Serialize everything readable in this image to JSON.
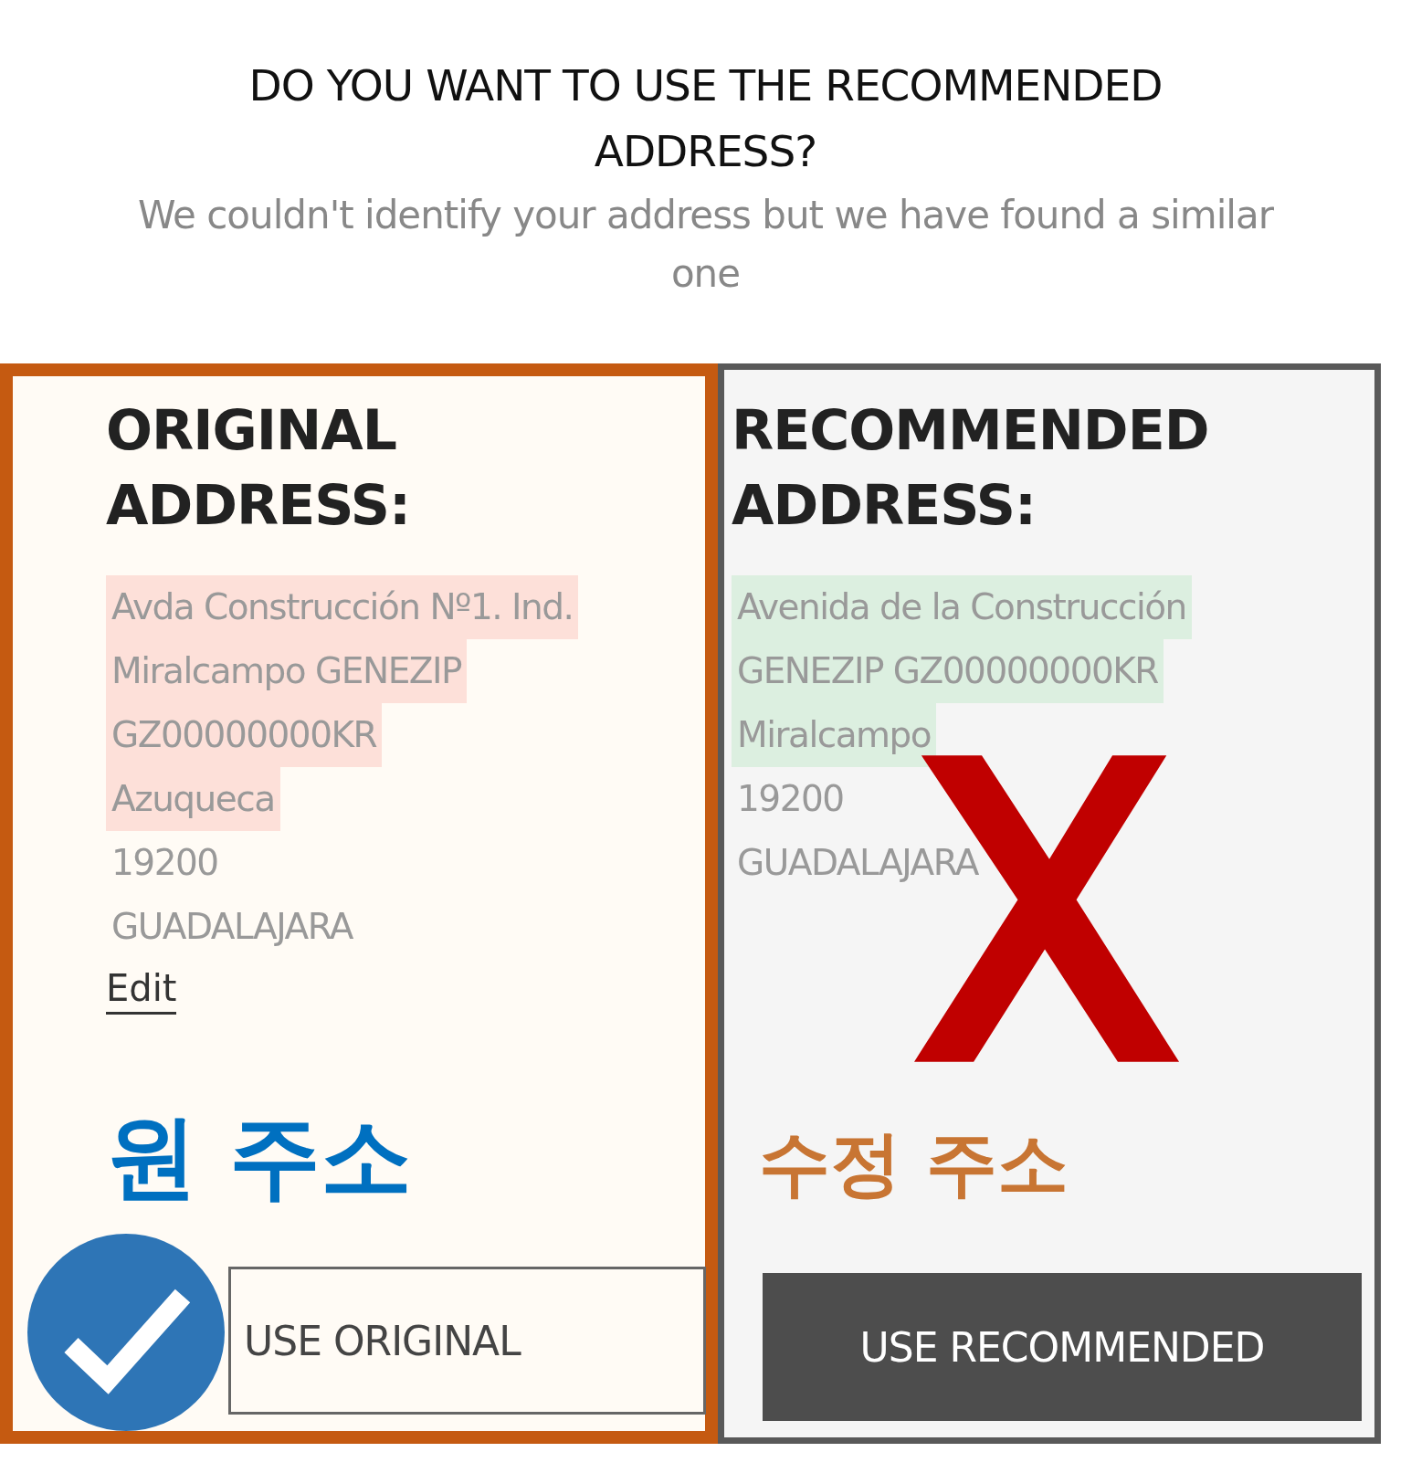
{
  "title": "DO YOU WANT TO USE THE RECOMMENDED ADDRESS?",
  "subtitle": "We couldn't identify your address but we have found a similar one",
  "cards": [
    {
      "kind": "original",
      "selected": true,
      "heading": "ORIGINAL ADDRESS:",
      "lines": [
        {
          "text": "Avda Construcción Nº1. Ind.",
          "highlighted": true
        },
        {
          "text": "Miralcampo GENEZIP",
          "highlighted": true
        },
        {
          "text": "GZ00000000KR",
          "highlighted": true
        },
        {
          "text": "Azuqueca",
          "highlighted": true
        },
        {
          "text": "19200",
          "highlighted": false
        },
        {
          "text": "GUADALAJARA",
          "highlighted": false
        }
      ],
      "edit_link": "Edit",
      "annotation": "원 주소",
      "button": "USE ORIGINAL"
    },
    {
      "kind": "recommended",
      "selected": false,
      "heading": "RECOMMENDED ADDRESS:",
      "lines": [
        {
          "text": "Avenida de la Construcción",
          "highlighted": true
        },
        {
          "text": "GENEZIP GZ00000000KR",
          "highlighted": true
        },
        {
          "text": "Miralcampo",
          "highlighted": true
        },
        {
          "text": "19200",
          "highlighted": false
        },
        {
          "text": "GUADALAJARA",
          "highlighted": false
        }
      ],
      "annotation": "수정 주소",
      "button": "USE RECOMMENDED"
    }
  ]
}
